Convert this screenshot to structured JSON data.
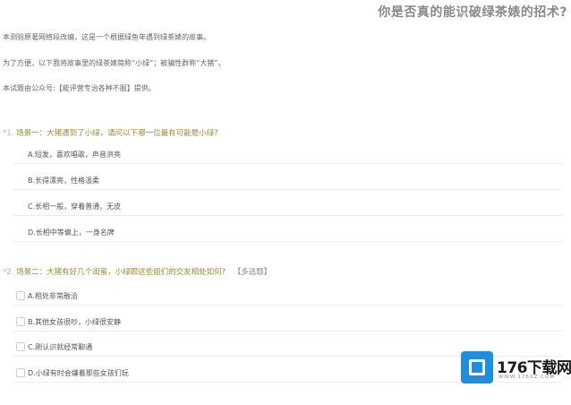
{
  "page": {
    "title": "你是否真的能识破绿茶婊的招术?"
  },
  "intro": [
    "本测验原著网络段改编，这是一个根据绿鱼年遇到绿茶婊的故事。",
    "为了方便，以下我将故事里的绿茶婊简称“小绿”；被骗性群称“大猪”。",
    "本试题由公众号:【能评营专治各种不服】提供。"
  ],
  "questions": [
    {
      "number": "*1.",
      "text": "场景一：大猪遇到了小绿，请问以下哪一位最有可能是小绿?",
      "tag": "",
      "options": [
        "A.短发，喜欢唱歌，声音洪亮",
        "B.长得漂亮，性格温柔",
        "C.长相一般，穿着普通，无皮",
        "D.长相中等偏上，一身名牌"
      ]
    },
    {
      "number": "*2.",
      "text": "场景二：大猪有好几个闺蜜，小绿跟这些姐们的交友相处如何?",
      "tag": "【多选题】",
      "options": [
        "A.相处非常融洽",
        "B.其他女孩很吵，小绿很安静",
        "C.刚认识就经常聊通",
        "D.小绿有时会嫌着那些女孩们玩"
      ]
    }
  ],
  "watermark": {
    "brand": "176下载网",
    "url": "WWW.176XZ.COM"
  },
  "colors": {
    "question_accent": "#9a8a38",
    "watermark_blue": "#1e8fe0"
  }
}
